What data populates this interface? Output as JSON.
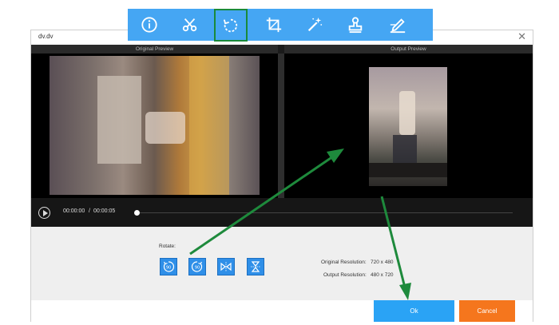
{
  "window": {
    "title": "dv.dv",
    "close_glyph": "✕"
  },
  "toolbar": {
    "tools": [
      {
        "name": "info-icon"
      },
      {
        "name": "scissors-icon"
      },
      {
        "name": "rotate-icon",
        "active": true
      },
      {
        "name": "crop-icon"
      },
      {
        "name": "effects-wand-icon"
      },
      {
        "name": "watermark-stamp-icon"
      },
      {
        "name": "subtitle-pen-icon"
      }
    ]
  },
  "preview": {
    "original_label": "Original Preview",
    "output_label": "Output Preview",
    "current_time": "00:00:00",
    "separator": "/",
    "total_time": "00:00:05",
    "progress": 0
  },
  "rotate": {
    "label": "Rotate:",
    "buttons": [
      {
        "name": "rotate-left-90-icon",
        "text": "90"
      },
      {
        "name": "rotate-right-90-icon",
        "text": "90"
      },
      {
        "name": "flip-horizontal-icon"
      },
      {
        "name": "flip-vertical-icon"
      }
    ]
  },
  "resolution": {
    "original_label": "Original Resolution:",
    "original_value": "720 x 480",
    "output_label": "Output Resolution:",
    "output_value": "480 x 720"
  },
  "footer": {
    "ok_label": "Ok",
    "cancel_label": "Cancel"
  },
  "colors": {
    "accent": "#45a6f3",
    "ok": "#2aa3f5",
    "cancel": "#f5761d",
    "highlight": "#1a8a3a"
  }
}
